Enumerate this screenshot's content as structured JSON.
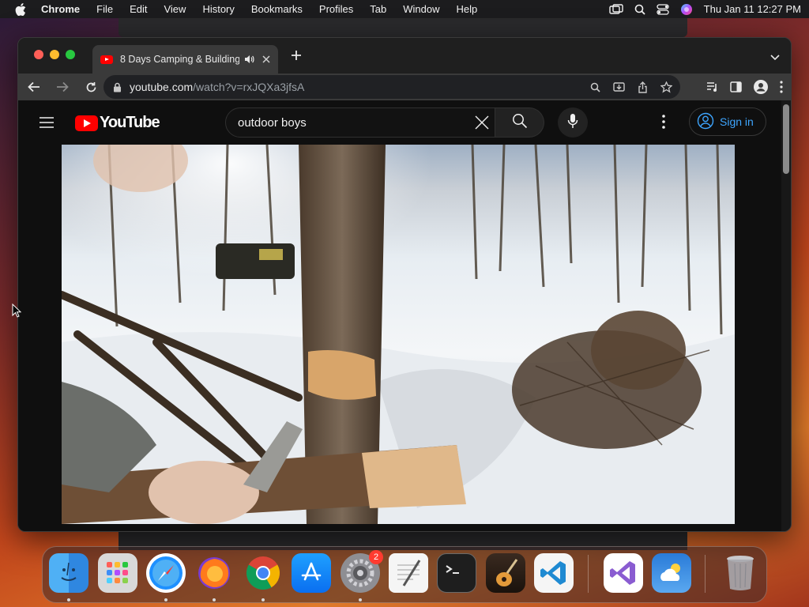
{
  "menubar": {
    "app_name": "Chrome",
    "items": [
      "File",
      "Edit",
      "View",
      "History",
      "Bookmarks",
      "Profiles",
      "Tab",
      "Window",
      "Help"
    ],
    "clock": "Thu Jan 11  12:27 PM",
    "status_icons": [
      "screen-mirroring-icon",
      "spotlight-search-icon",
      "control-center-icon",
      "siri-icon"
    ]
  },
  "browser": {
    "tab": {
      "title": "8 Days Camping & Building",
      "favicon": "youtube-favicon-icon",
      "audio": "speaker-icon"
    },
    "address": {
      "host": "youtube.com",
      "path": "/watch?v=rxJQXa3jfsA"
    }
  },
  "youtube": {
    "logo_text": "YouTube",
    "search": {
      "value": "outdoor boys"
    },
    "sign_in_label": "Sign in",
    "colors": {
      "brand_red": "#ff0000",
      "link_blue": "#3ea6ff",
      "page_bg": "#0f0f0f"
    }
  },
  "dock": {
    "apps": [
      {
        "name": "Finder",
        "icon": "finder-icon"
      },
      {
        "name": "Launchpad",
        "icon": "launchpad-icon"
      },
      {
        "name": "Safari",
        "icon": "safari-icon"
      },
      {
        "name": "Firefox",
        "icon": "firefox-icon"
      },
      {
        "name": "Google Chrome",
        "icon": "chrome-icon"
      },
      {
        "name": "App Store",
        "icon": "app-store-icon"
      },
      {
        "name": "System Settings",
        "icon": "system-settings-icon",
        "badge": "2"
      },
      {
        "name": "TextEdit",
        "icon": "textedit-icon"
      },
      {
        "name": "Terminal",
        "icon": "terminal-icon"
      },
      {
        "name": "GarageBand",
        "icon": "garageband-icon"
      },
      {
        "name": "Visual Studio Code",
        "icon": "vscode-icon"
      },
      {
        "name": "Visual Studio",
        "icon": "visual-studio-icon"
      },
      {
        "name": "Weather",
        "icon": "weather-icon"
      },
      {
        "name": "Trash",
        "icon": "trash-icon"
      }
    ]
  }
}
